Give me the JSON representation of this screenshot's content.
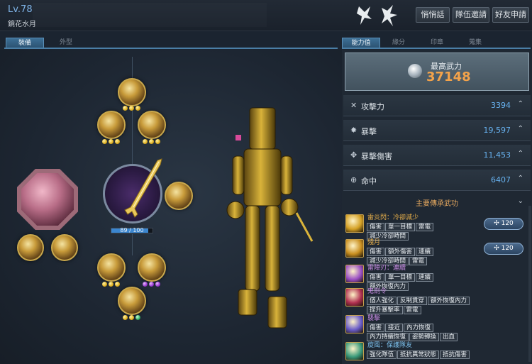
{
  "player": {
    "level": "Lv.78",
    "name": "鏡花水月"
  },
  "top_buttons": {
    "whisper": "悄悄話",
    "party_invite": "隊伍邀請",
    "friend_request": "好友申請"
  },
  "left_tabs": {
    "equip": "裝備",
    "appearance": "外型"
  },
  "right_tabs": {
    "ability": "能力值",
    "fate": "緣分",
    "seal": "印章",
    "collect": "蒐集"
  },
  "weapon": {
    "durability_text": "89 / 100",
    "durability_ratio": 0.89
  },
  "power": {
    "label": "最高武力",
    "value": "37148"
  },
  "stats": [
    {
      "icon": "swords-icon",
      "label": "攻擊力",
      "value": "3394"
    },
    {
      "icon": "burst-icon",
      "label": "暴擊",
      "value": "19,597"
    },
    {
      "icon": "crosshair-burst-icon",
      "label": "暴擊傷害",
      "value": "11,453"
    },
    {
      "icon": "target-icon",
      "label": "命中",
      "value": "6407"
    }
  ],
  "skills_section": {
    "title": "主要傳承武功"
  },
  "skills": [
    {
      "name": "雷炎閃：冷卻減少",
      "name_color": "#e8b04a",
      "icon_color": "#d4a024",
      "tags": [
        "傷害",
        "單一目標",
        "雷電",
        "減少冷卻時間"
      ],
      "level": "120"
    },
    {
      "name": "殘月",
      "name_color": "#e8b04a",
      "icon_color": "#c98f20",
      "tags": [
        "傷害",
        "額外傷害",
        "連續",
        "減少冷卻時間",
        "雷電"
      ],
      "level": "120"
    },
    {
      "name": "雷陣刃：連續",
      "name_color": "#c58ae0",
      "icon_color": "#9b4fc4",
      "tags": [
        "傷害",
        "單一目標",
        "連續",
        "額外恢復內力"
      ],
      "level": ""
    },
    {
      "name": "鬼劍令",
      "name_color": "#c58ae0",
      "icon_color": "#b03050",
      "tags": [
        "個人強化",
        "反制貫穿",
        "額外恢復內力",
        "提升暴擊率",
        "雷電"
      ],
      "level": ""
    },
    {
      "name": "襲擊",
      "name_color": "#c58ae0",
      "icon_color": "#6a5cc8",
      "tags": [
        "傷害",
        "接近",
        "內力恢復",
        "內力持續恢復",
        "姿勢轉換",
        "出血"
      ],
      "level": ""
    },
    {
      "name": "旋風：保護隊友",
      "name_color": "#7fc4f0",
      "icon_color": "#3a9a7a",
      "tags": [
        "強化隊伍",
        "抵抗異常狀態",
        "抵抗傷害"
      ],
      "level": ""
    }
  ],
  "colors": {
    "accent_blue": "#4a7ea6",
    "power_orange": "#f4a34a",
    "stat_blue": "#67b2f0"
  }
}
